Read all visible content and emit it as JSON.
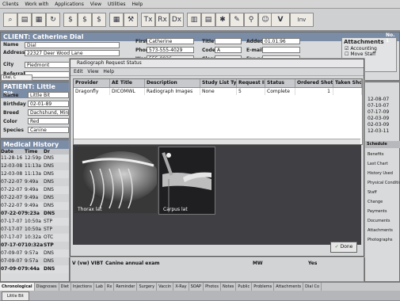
{
  "menu": [
    "Clients",
    "Work with",
    "Applications",
    "View",
    "Utilities",
    "Help"
  ],
  "toolbar_icons": [
    "search-icon",
    "print-icon",
    "calendar-icon",
    "dollar-icon",
    "dollar-icon",
    "invoice-icon",
    "tools-icon",
    "treatment-icon",
    "rx-icon",
    "diagnosis-icon",
    "grid-icon",
    "document-icon",
    "xray-icon",
    "edit-icon",
    "tool-icon",
    "people-icon",
    "vetting-icon",
    "inventory-icon"
  ],
  "client": {
    "title": "CLIENT: Catherine Dial",
    "labels": [
      "Name",
      "Address",
      "City",
      "Referral"
    ],
    "values": [
      "Dial",
      "22327 Deer Wood Lane",
      "Piedmont",
      ""
    ],
    "right_labels": [
      "First",
      "Phone",
      "Work",
      "Title",
      "Codes",
      "Class",
      "Added",
      "E-mail",
      "Fax no."
    ],
    "right_values": [
      "Catherine",
      "573-555-4029",
      "555-0026",
      "",
      "A",
      "",
      "01.01.96",
      "",
      ""
    ],
    "tab": "Dial, C",
    "attachments_title": "Attachments",
    "attachments": [
      "Accounting",
      "Move Staff"
    ],
    "number": "No. 1"
  },
  "patient": {
    "title": "PATIENT: Little Bit",
    "labels": [
      "Name",
      "Birthday",
      "Breed",
      "Color",
      "Species"
    ],
    "values": [
      "Little Bit",
      "02-01-89",
      "Dachshund, Minia",
      "Red",
      "Canine"
    ]
  },
  "history": {
    "title": "Medical History",
    "headers": [
      "Date",
      "Time",
      "Dr"
    ],
    "rows": [
      [
        "11-28-16",
        "12:59p",
        "DNS"
      ],
      [
        "12-03-08",
        "11:13a",
        "DNS"
      ],
      [
        "12-03-08",
        "11:13a",
        "DNS"
      ],
      [
        "07-22-07",
        "9:49a",
        "DNS"
      ],
      [
        "07-22-07",
        "9:49a",
        "DNS"
      ],
      [
        "07-22-07",
        "9:49a",
        "DNS"
      ],
      [
        "07-22-07",
        "9:49a",
        "DNS"
      ],
      [
        "07-22-07",
        "9:23a",
        "DNS"
      ],
      [
        "07-17-07",
        "10:50a",
        "STP"
      ],
      [
        "07-17-07",
        "10:50a",
        "STP"
      ],
      [
        "07-17-07",
        "10:32a",
        "OTC"
      ],
      [
        "07-17-07",
        "10:32a",
        "STP"
      ],
      [
        "07-09-07",
        "9:57a",
        "DNS"
      ],
      [
        "07-09-07",
        "9:57a",
        "DNS"
      ],
      [
        "07-09-07",
        "9:44a",
        "DNS"
      ]
    ],
    "last_row_extra": [
      "V (vw) VIBT",
      "Canine annual exam",
      "MW",
      "Yes"
    ]
  },
  "right_list": [
    "12-08-07",
    "07-10-07",
    "07-17-09",
    "02-03-09",
    "02-03-09",
    "12-03-11"
  ],
  "right_links": [
    "Schedule",
    "Benefits",
    "Last Chart",
    "History Used",
    "Physical Condition",
    "Staff",
    "Change",
    "Payments",
    "Documents",
    "Attachments",
    "Photographs"
  ],
  "dialog": {
    "title": "Radiograph Request Status",
    "menu": [
      "Edit",
      "View",
      "Help"
    ],
    "columns": [
      "Provider",
      "AE Title",
      "Description",
      "Study List Type",
      "Request ID",
      "Status",
      "Ordered Shots",
      "Taken Shots"
    ],
    "rows": [
      [
        "Dragonfly",
        "DICOMWL",
        "Radiograph Images",
        "None",
        "5",
        "Complete",
        "1",
        ""
      ]
    ],
    "images": [
      {
        "caption": "Thorax lat"
      },
      {
        "caption": "Carpus lat"
      }
    ],
    "done_label": "Done"
  },
  "bottom_tabs": [
    "Chronological",
    "Diagnoses",
    "Diet",
    "Injections",
    "Lab",
    "Rx",
    "Reminder",
    "Surgery",
    "Vaccin",
    "X-Ray",
    "SOAP",
    "Photos",
    "Notes",
    "Public",
    "Problems",
    "Attachments",
    "Dial Co"
  ],
  "bottom_tab2": "Little Bit"
}
